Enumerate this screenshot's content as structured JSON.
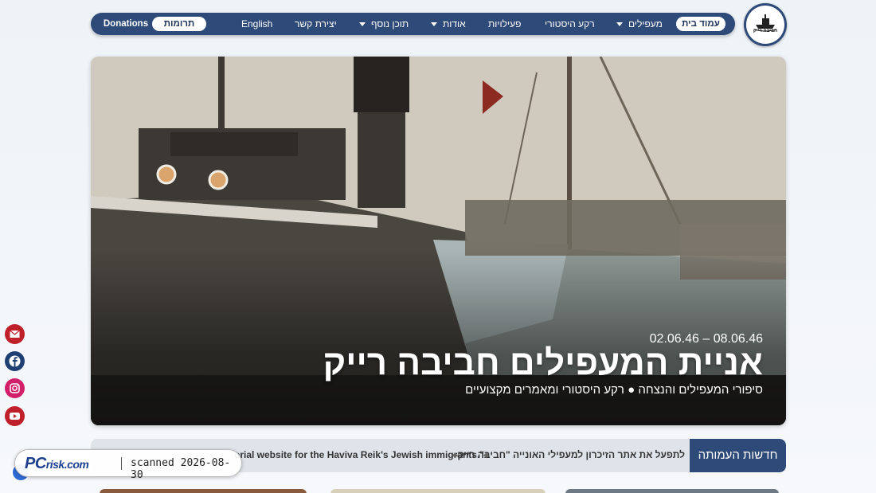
{
  "nav": {
    "home": "עמוד בית",
    "immigrants": "מעפילים",
    "background": "רקע היסטורי",
    "activities": "פעילויות",
    "about": "אודות",
    "more": "תוכן נוסף",
    "contact": "יצירת קשר",
    "english": "English",
    "donations_he": "תרומות",
    "donations_en": "Donations"
  },
  "logo": {
    "text": "חביבה רייק"
  },
  "hero": {
    "dates": "02.06.46 – 08.06.46",
    "title": "אניית המעפילים חביבה רייק",
    "subtitle": "סיפורי המעפילים והנצחה ● רקע היסטורי ומאמרים מקצועיים"
  },
  "ticker": {
    "label": "חדשות העמותה",
    "item_he": "לתפעל את אתר הזיכרון למעפילי האונייה \"חביבה רייק",
    "item_en": "orial website for the Haviva Reik's Jewish immigrants.\""
  },
  "social": {
    "email": "email-icon",
    "facebook": "facebook-icon",
    "instagram": "instagram-icon",
    "youtube": "youtube-icon"
  },
  "watermark": {
    "brand": "PC",
    "brand_suffix": "risk.com",
    "text": "scanned 2026-08-30"
  }
}
